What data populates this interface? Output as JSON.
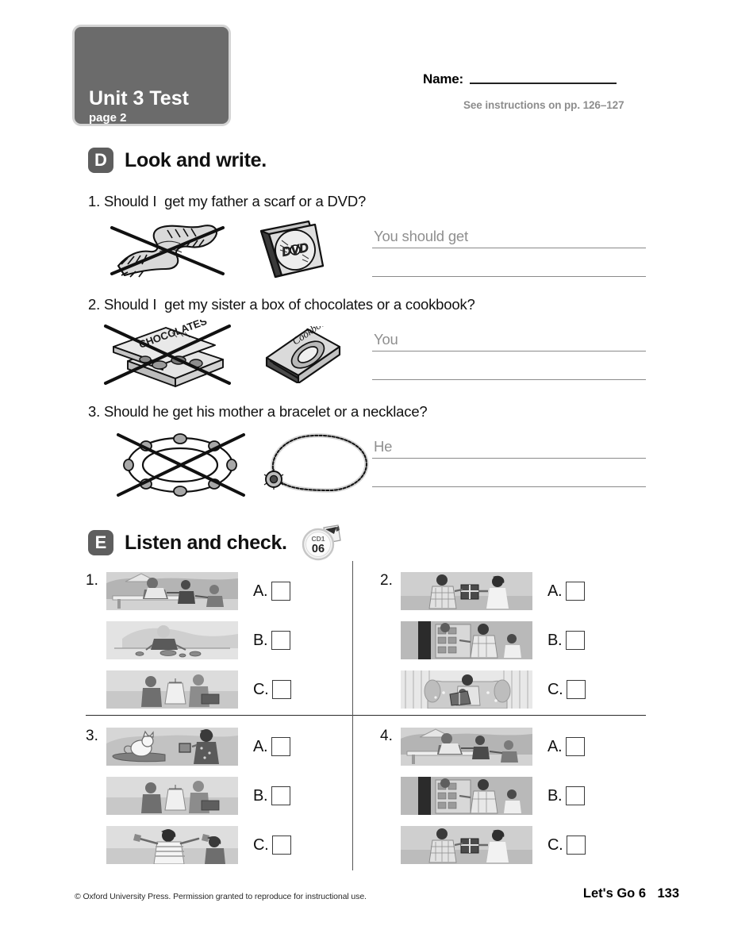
{
  "header": {
    "unit_title": "Unit 3 Test",
    "page_label": "page 2",
    "name_label": "Name:",
    "instructions": "See instructions on pp. 126–127"
  },
  "section_d": {
    "letter": "D",
    "title": "Look and write.",
    "questions": [
      {
        "number": "1.",
        "text": "1. Should I  get my father a scarf or a DVD?",
        "crossed_item": "scarf",
        "chosen_item": "dvd-case",
        "dvd_label": "DVD",
        "hint": "You should get"
      },
      {
        "number": "2.",
        "text": "2. Should I  get my sister a box of chocolates or a cookbook?",
        "crossed_item": "box-of-chocolates",
        "chosen_item": "cookbook",
        "chocolates_label": "CHOCOLATES",
        "cookbook_label": "Cookbook",
        "hint": "You"
      },
      {
        "number": "3.",
        "text": "3. Should he get his mother a bracelet or a necklace?",
        "crossed_item": "bracelet",
        "chosen_item": "necklace",
        "hint": "He"
      }
    ]
  },
  "section_e": {
    "letter": "E",
    "title": "Listen and check.",
    "audio_icon": {
      "disc": "CD1",
      "track": "06"
    },
    "items": [
      {
        "number": "1.",
        "options": [
          {
            "label": "A.",
            "scene": "man-at-picnic-table-serving-children",
            "checked": false
          },
          {
            "label": "B.",
            "scene": "person-at-table-with-coins",
            "checked": false
          },
          {
            "label": "C.",
            "scene": "two-people-shopping-with-hanger",
            "checked": false
          }
        ]
      },
      {
        "number": "2.",
        "options": [
          {
            "label": "A.",
            "scene": "boy-giving-gift-box-to-girl",
            "checked": false
          },
          {
            "label": "B.",
            "scene": "people-at-store-shelves",
            "checked": false
          },
          {
            "label": "C.",
            "scene": "adult-reading-book-to-child-on-sofa",
            "checked": false
          }
        ]
      },
      {
        "number": "3.",
        "options": [
          {
            "label": "A.",
            "scene": "girl-photographing-cat-on-table",
            "checked": false
          },
          {
            "label": "B.",
            "scene": "two-people-shopping-with-hanger",
            "checked": false
          },
          {
            "label": "C.",
            "scene": "girl-with-arms-open-greeting",
            "checked": false
          }
        ]
      },
      {
        "number": "4.",
        "options": [
          {
            "label": "A.",
            "scene": "man-at-picnic-table-serving-children",
            "checked": false
          },
          {
            "label": "B.",
            "scene": "people-at-store-shelves",
            "checked": false
          },
          {
            "label": "C.",
            "scene": "boy-giving-gift-box-to-girl",
            "checked": false
          }
        ]
      }
    ]
  },
  "footer": {
    "copyright": "© Oxford University Press. Permission granted to reproduce for instructional use.",
    "book": "Let's Go 6",
    "page_number": "133"
  },
  "colors": {
    "badge_gray": "#6b6b6b",
    "badge_border": "#d4d4d4",
    "letter_badge": "#5e5e5e",
    "hint_gray": "#8f8f8f",
    "rule_gray": "#8a8a8a",
    "instructions_gray": "#8d8d8d"
  }
}
